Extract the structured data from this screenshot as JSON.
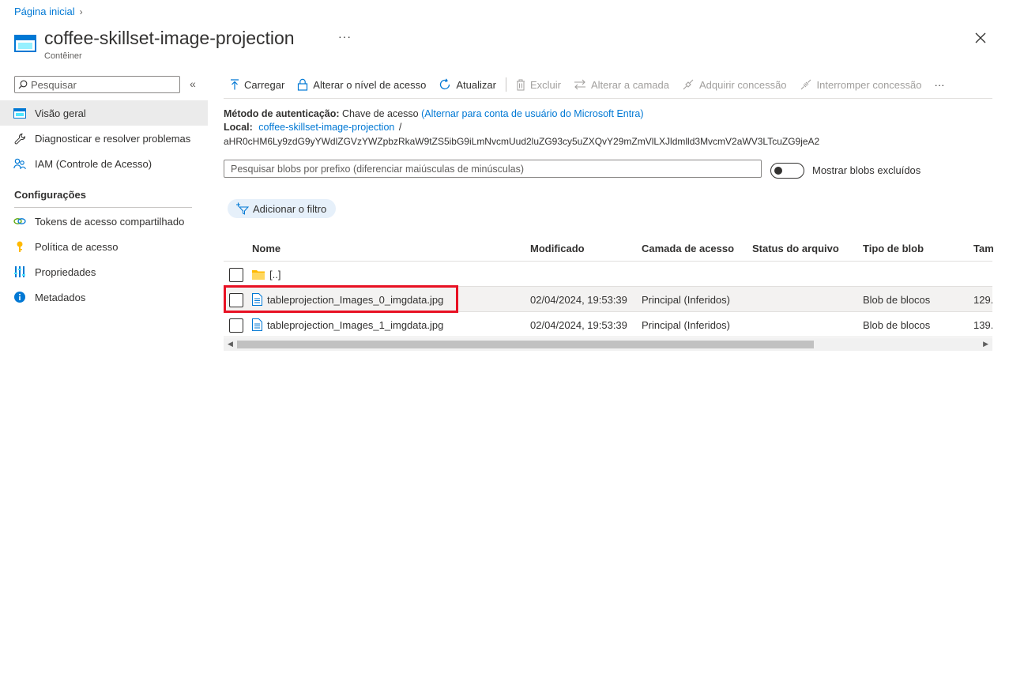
{
  "breadcrumb": {
    "home": "Página inicial",
    "separator": "›"
  },
  "header": {
    "title": "coffee-skillset-image-projection",
    "subtitle": "Contêiner",
    "more": "···"
  },
  "sidebar": {
    "search_placeholder": "Pesquisar",
    "collapse": "«",
    "items": [
      {
        "label": "Visão geral",
        "icon": "container-icon"
      },
      {
        "label": "Diagnosticar e resolver problemas",
        "icon": "wrench-icon"
      },
      {
        "label": "IAM (Controle de Acesso)",
        "icon": "people-icon"
      }
    ],
    "section_title": "Configurações",
    "settings_items": [
      {
        "label": "Tokens de acesso compartilhado",
        "icon": "link-icon"
      },
      {
        "label": "Política de acesso",
        "icon": "key-icon"
      },
      {
        "label": "Propriedades",
        "icon": "bars-icon"
      },
      {
        "label": "Metadados",
        "icon": "info-icon"
      }
    ]
  },
  "toolbar": {
    "upload": "Carregar",
    "change_access": "Alterar o nível de acesso",
    "refresh": "Atualizar",
    "delete": "Excluir",
    "change_tier": "Alterar a camada",
    "acquire_lease": "Adquirir concessão",
    "break_lease": "Interromper concessão",
    "more": "···"
  },
  "info": {
    "auth_label": "Método de autenticação:",
    "auth_value": "Chave de acesso",
    "auth_switch": "(Alternar para conta de usuário do Microsoft Entra)",
    "location_label": "Local:",
    "location_link": "coffee-skillset-image-projection",
    "location_sep": "/",
    "path": "aHR0cHM6Ly9zdG9yYWdlZGVzYWZpbzRkaW9tZS5ibG9iLmNvcmUud2luZG93cy5uZXQvY29mZmVlLXJldmlld3MvcmV2aWV3LTcuZG9jeA2"
  },
  "blob_search": {
    "placeholder": "Pesquisar blobs por prefixo (diferenciar maiúsculas de minúsculas)"
  },
  "toggle": {
    "label": "Mostrar blobs excluídos",
    "state": "off"
  },
  "filter": {
    "label": "Adicionar o filtro"
  },
  "table": {
    "columns": [
      "Nome",
      "Modificado",
      "Camada de acesso",
      "Status do arquivo",
      "Tipo de blob",
      "Tam"
    ],
    "rows": [
      {
        "name": "[..]",
        "type": "folder",
        "modified": "",
        "tier": "",
        "status": "",
        "blob_type": "",
        "size": ""
      },
      {
        "name": "tableprojection_Images_0_imgdata.jpg",
        "type": "file",
        "modified": "02/04/2024, 19:53:39",
        "tier": "Principal (Inferidos)",
        "status": "",
        "blob_type": "Blob de blocos",
        "size": "129."
      },
      {
        "name": "tableprojection_Images_1_imgdata.jpg",
        "type": "file",
        "modified": "02/04/2024, 19:53:39",
        "tier": "Principal (Inferidos)",
        "status": "",
        "blob_type": "Blob de blocos",
        "size": "139."
      }
    ]
  },
  "colors": {
    "accent": "#0078d4",
    "highlight": "#e81123",
    "folder": "#ffb900"
  }
}
